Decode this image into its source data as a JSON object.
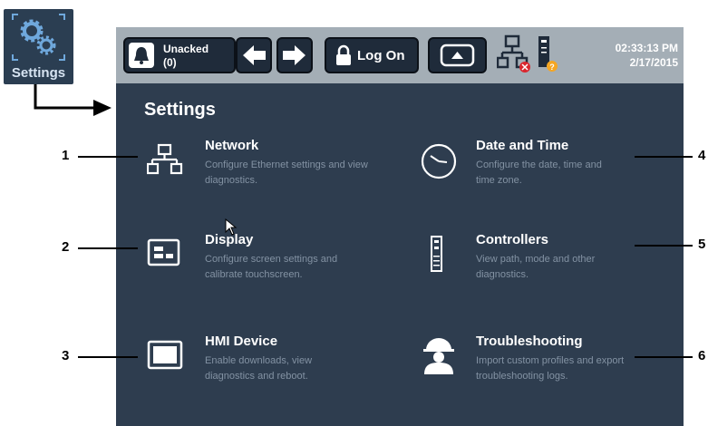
{
  "settings_tile": {
    "label": "Settings"
  },
  "topbar": {
    "alarm_line1": "Unacked",
    "alarm_line2": "(0)",
    "logon_label": "Log On",
    "time": "02:33:13 PM",
    "date": "2/17/2015"
  },
  "page_title": "Settings",
  "items": [
    {
      "title": "Network",
      "desc": "Configure Ethernet settings and view diagnostics.",
      "icon": "network-icon"
    },
    {
      "title": "Date and Time",
      "desc": "Configure the date, time and time zone.",
      "icon": "clock-icon"
    },
    {
      "title": "Display",
      "desc": "Configure screen settings and calibrate touchscreen.",
      "icon": "display-icon"
    },
    {
      "title": "Controllers",
      "desc": "View path, mode and other diagnostics.",
      "icon": "controller-icon"
    },
    {
      "title": "HMI Device",
      "desc": "Enable downloads, view diagnostics and reboot.",
      "icon": "hmi-device-icon"
    },
    {
      "title": "Troubleshooting",
      "desc": "Import custom profiles and export troubleshooting logs.",
      "icon": "worker-icon"
    }
  ],
  "callouts": [
    "1",
    "2",
    "3",
    "4",
    "5",
    "6"
  ]
}
